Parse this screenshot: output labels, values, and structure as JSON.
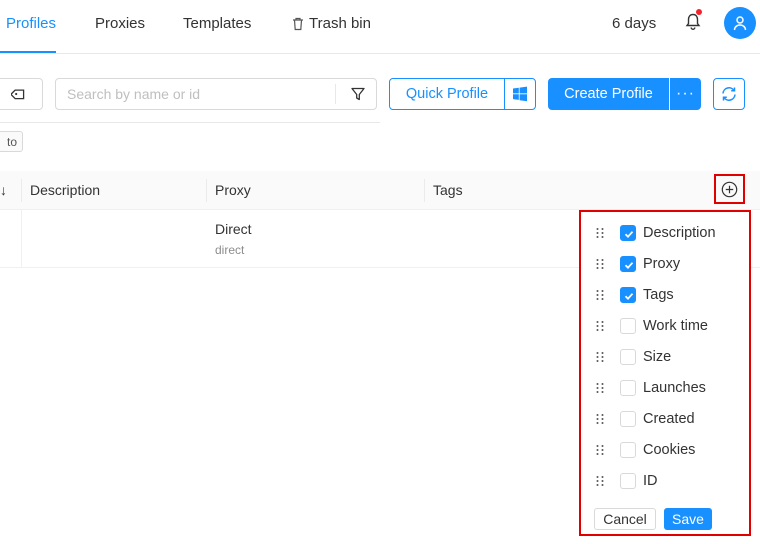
{
  "nav": {
    "tabs": [
      {
        "label": "Profiles",
        "active": true
      },
      {
        "label": "Proxies",
        "active": false
      },
      {
        "label": "Templates",
        "active": false
      },
      {
        "label": "Trash bin",
        "active": false,
        "icon": "trash-icon"
      }
    ],
    "days_left": "6 days",
    "notification_dot": true,
    "accent_color": "#1890ff"
  },
  "toolbar": {
    "search_placeholder": "Search by name or id",
    "quick_profile_label": "Quick Profile",
    "create_profile_label": "Create Profile",
    "more_label": "···"
  },
  "filter_chip": {
    "text": "to"
  },
  "table": {
    "columns": [
      "Description",
      "Proxy",
      "Tags"
    ],
    "rows": [
      {
        "description": "",
        "proxy": "Direct",
        "proxy_sub": "direct",
        "tags": ""
      }
    ]
  },
  "column_menu": {
    "items": [
      {
        "label": "Description",
        "checked": true
      },
      {
        "label": "Proxy",
        "checked": true
      },
      {
        "label": "Tags",
        "checked": true
      },
      {
        "label": "Work time",
        "checked": false
      },
      {
        "label": "Size",
        "checked": false
      },
      {
        "label": "Launches",
        "checked": false
      },
      {
        "label": "Created",
        "checked": false
      },
      {
        "label": "Cookies",
        "checked": false
      },
      {
        "label": "ID",
        "checked": false
      }
    ],
    "cancel_label": "Cancel",
    "save_label": "Save",
    "highlight_color": "#e00000"
  }
}
